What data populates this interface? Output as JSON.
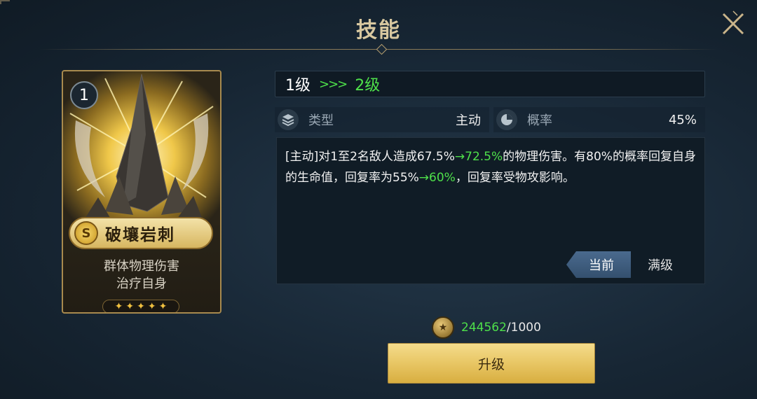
{
  "title": "技能",
  "card": {
    "level_badge": "1",
    "rank_letter": "S",
    "name": "破壤岩刺",
    "desc_line1": "群体物理伤害",
    "desc_line2": "治疗自身",
    "stars": 5,
    "art_icon": "rock-spike-icon"
  },
  "level": {
    "from": "1级",
    "arrow": ">>>",
    "to": "2级"
  },
  "stats": {
    "type_label": "类型",
    "type_value": "主动",
    "type_icon": "layers-icon",
    "rate_label": "概率",
    "rate_value": "45%",
    "rate_icon": "pie-icon"
  },
  "description": {
    "part1": "[主动]对1至2名敌人造成67.5%",
    "up1": "→72.5%",
    "part2": "的物理伤害。有80%的概率回复自身的生命值，回复率为55%",
    "up2": "→60%",
    "part3": "，回复率受物攻影响。"
  },
  "tabs": {
    "current": "当前",
    "max": "满级"
  },
  "cost": {
    "have": "244562",
    "need": "/1000",
    "icon": "coin-icon"
  },
  "upgrade_label": "升级",
  "colors": {
    "accent_green": "#4ee04a",
    "gold": "#e8c664",
    "bg": "#172634"
  }
}
